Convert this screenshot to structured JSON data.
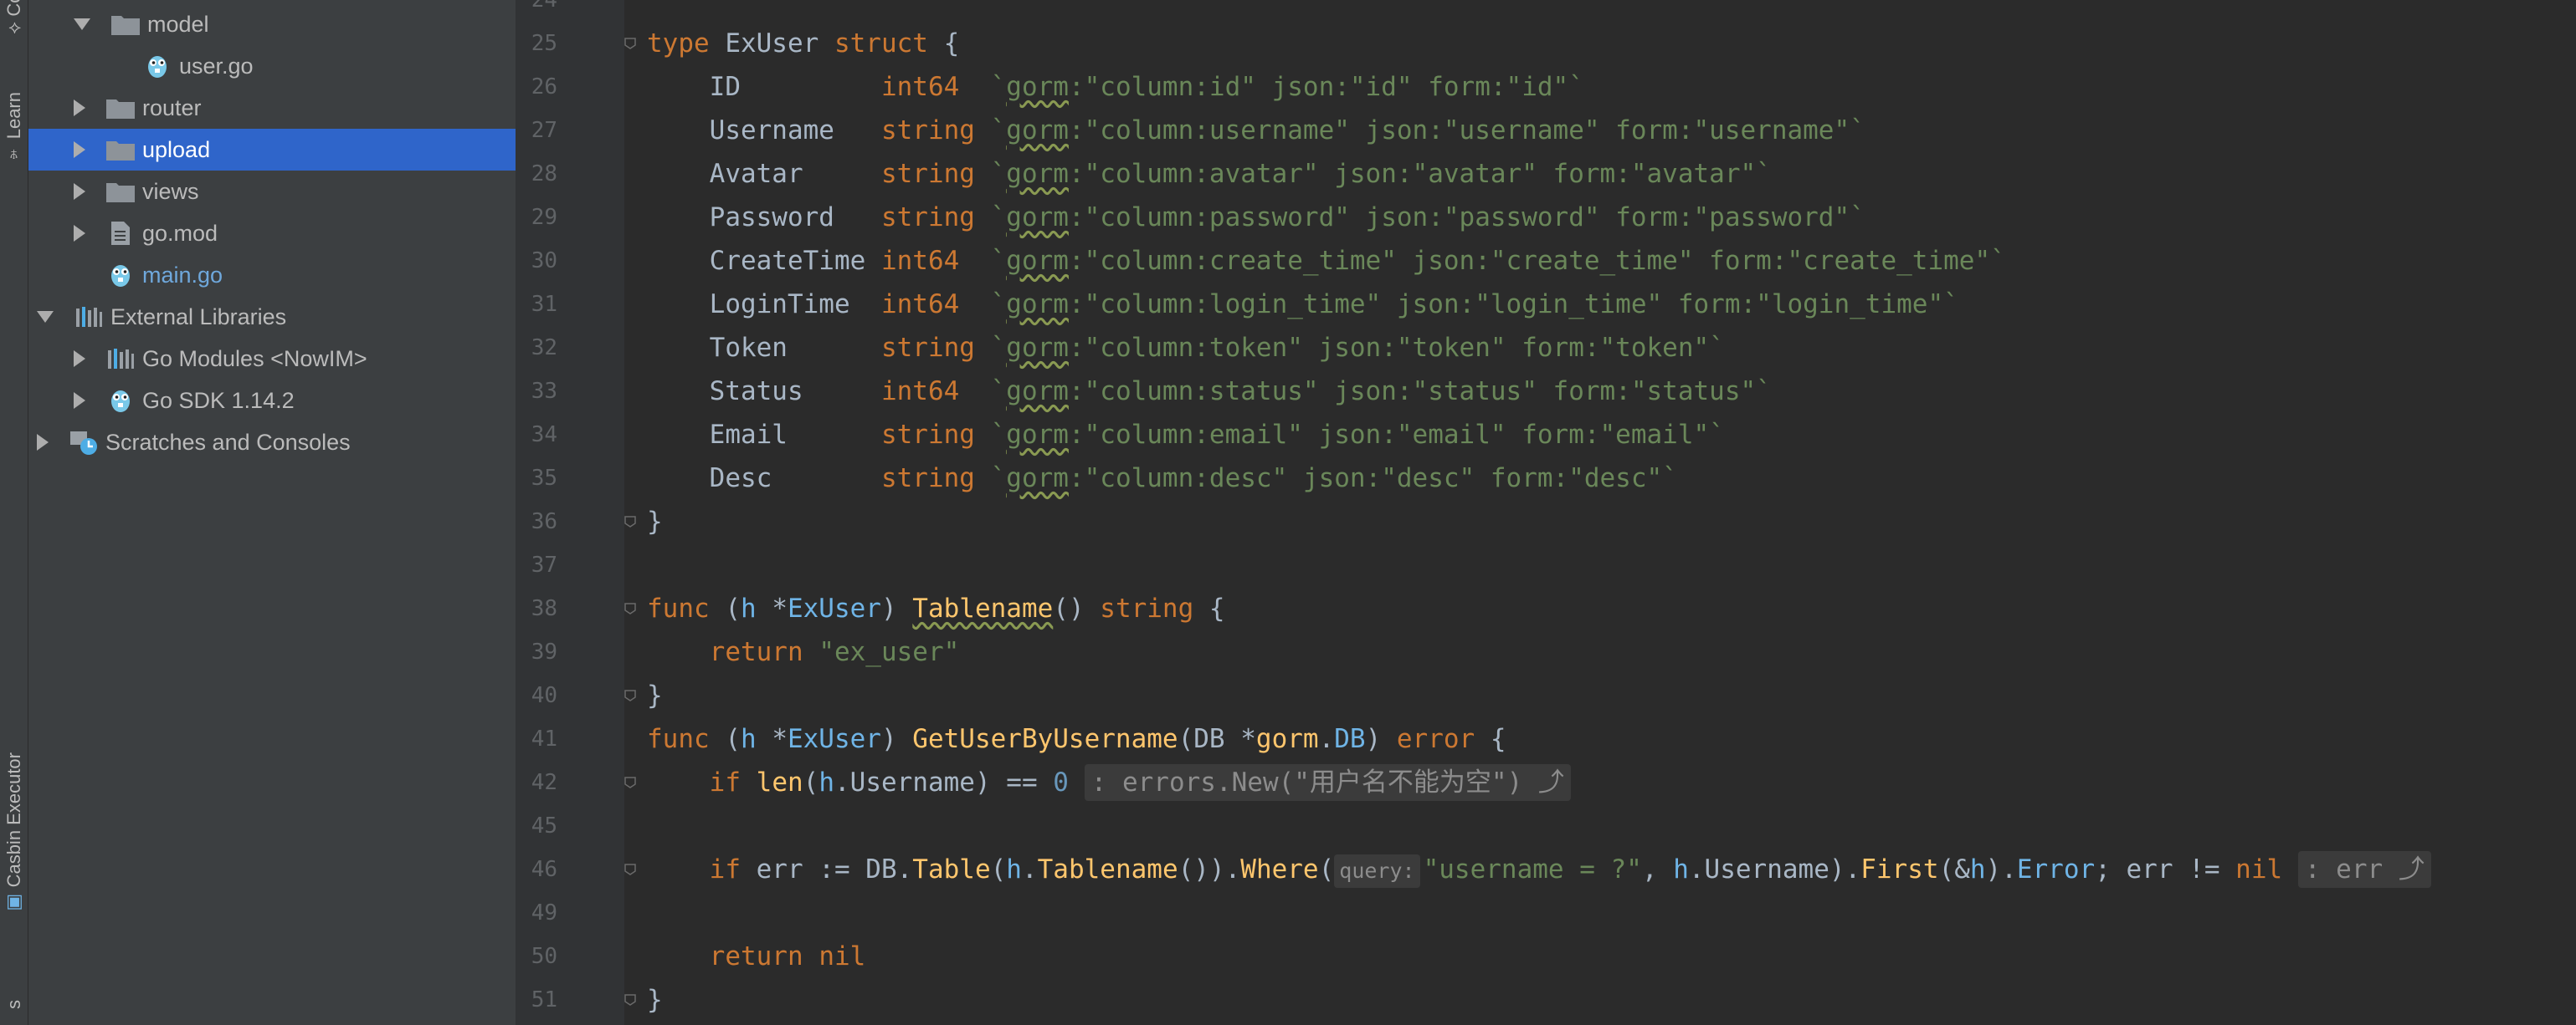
{
  "toolstrip": {
    "top_tab": "Co",
    "learn_tab": "Learn",
    "casbin_tab": "Casbin Executor",
    "bottom_tab": "s"
  },
  "tree": {
    "items": [
      {
        "label": "model",
        "indent": 1,
        "arrow": "down",
        "icon": "folder-icon"
      },
      {
        "label": "user.go",
        "indent": 2,
        "arrow": "none",
        "icon": "go-file-icon"
      },
      {
        "label": "router",
        "indent": 1,
        "arrow": "right",
        "icon": "folder-icon"
      },
      {
        "label": "upload",
        "indent": 1,
        "arrow": "right",
        "icon": "folder-icon",
        "selected": true
      },
      {
        "label": "views",
        "indent": 1,
        "arrow": "right",
        "icon": "folder-icon"
      },
      {
        "label": "go.mod",
        "indent": 1,
        "arrow": "right",
        "icon": "file-icon"
      },
      {
        "label": "main.go",
        "indent": 1,
        "arrow": "none",
        "icon": "go-file-icon",
        "blue": true
      },
      {
        "label": "External Libraries",
        "indent": 0,
        "arrow": "down",
        "icon": "library-icon"
      },
      {
        "label": "Go Modules <NowIM>",
        "indent": 1,
        "arrow": "right",
        "icon": "library-icon"
      },
      {
        "label": "Go SDK 1.14.2",
        "indent": 1,
        "arrow": "right",
        "icon": "go-file-icon"
      },
      {
        "label": "Scratches and Consoles",
        "indent": 0,
        "arrow": "right",
        "icon": "scratches-icon"
      }
    ]
  },
  "editor": {
    "line_numbers": [
      "24",
      "25",
      "26",
      "27",
      "28",
      "29",
      "30",
      "31",
      "32",
      "33",
      "34",
      "35",
      "36",
      "37",
      "38",
      "39",
      "40",
      "41",
      "42",
      "45",
      "46",
      "49",
      "50",
      "51"
    ],
    "hints": {
      "fold_42": ": errors.New(\"用户名不能为空\") ⤴",
      "param_query": "query:",
      "fold_46": ": err ⤴"
    }
  },
  "colors": {
    "keyword": "#cc7832",
    "string": "#6a8759",
    "function": "#ffc66d",
    "number": "#6897bb",
    "default": "#a9b7c6",
    "selection": "#2f65ca",
    "panel": "#3c3f41",
    "editor_bg": "#2b2b2b"
  }
}
